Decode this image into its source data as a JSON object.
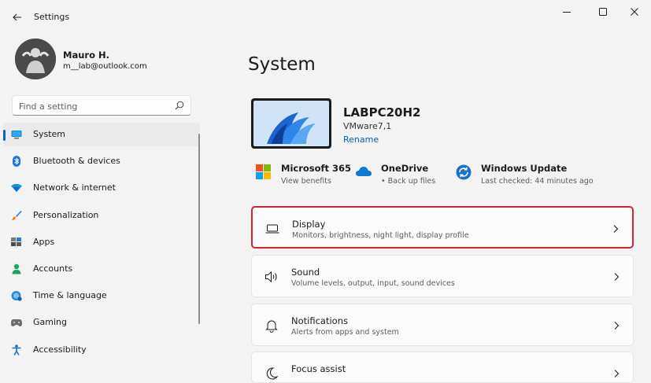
{
  "window": {
    "title": "Settings"
  },
  "profile": {
    "name": "Mauro H.",
    "email": "m__lab@outlook.com"
  },
  "search": {
    "placeholder": "Find a setting"
  },
  "nav": {
    "items": [
      {
        "label": "System",
        "icon": "monitor-icon"
      },
      {
        "label": "Bluetooth & devices",
        "icon": "bluetooth-icon"
      },
      {
        "label": "Network & internet",
        "icon": "wifi-icon"
      },
      {
        "label": "Personalization",
        "icon": "brush-icon"
      },
      {
        "label": "Apps",
        "icon": "apps-icon"
      },
      {
        "label": "Accounts",
        "icon": "person-icon"
      },
      {
        "label": "Time & language",
        "icon": "globe-clock-icon"
      },
      {
        "label": "Gaming",
        "icon": "gamepad-icon"
      },
      {
        "label": "Accessibility",
        "icon": "accessibility-icon"
      }
    ],
    "selected": "System"
  },
  "main": {
    "title": "System",
    "device": {
      "name": "LABPC20H2",
      "model": "VMware7,1",
      "rename": "Rename"
    },
    "quick": [
      {
        "title": "Microsoft 365",
        "sub": "View benefits"
      },
      {
        "title": "OneDrive",
        "sub": "• Back up files"
      },
      {
        "title": "Windows Update",
        "sub": "Last checked: 44 minutes ago"
      }
    ],
    "cards": [
      {
        "title": "Display",
        "sub": "Monitors, brightness, night light, display profile"
      },
      {
        "title": "Sound",
        "sub": "Volume levels, output, input, sound devices"
      },
      {
        "title": "Notifications",
        "sub": "Alerts from apps and system"
      },
      {
        "title": "Focus assist",
        "sub": ""
      }
    ]
  },
  "colors": {
    "accent": "#0067c0",
    "highlight": "#d6232f"
  }
}
